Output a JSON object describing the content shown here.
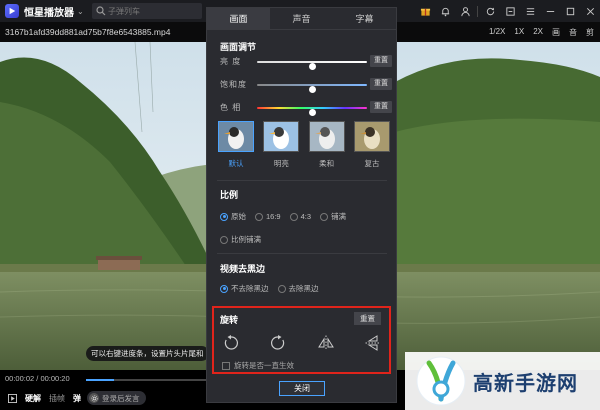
{
  "app": {
    "name": "恒星播放器"
  },
  "search": {
    "placeholder": "子弹列车"
  },
  "file": {
    "name": "3167b1afd39dd881ad75b7f8e6543885.mp4"
  },
  "view_options": [
    "1/2X",
    "1X",
    "2X",
    "画",
    "音",
    "剪"
  ],
  "tooltip": "可以右键进度条，设置片头片尾和",
  "playback": {
    "time": "00:00:02 / 00:00:20",
    "progress_fraction": 0.23
  },
  "controls": {
    "hard_decode": "硬解",
    "screenshot": "插帧",
    "danmaku": "弹",
    "danmaku_placeholder": "登录后发言"
  },
  "panel": {
    "tabs": [
      "画面",
      "声音",
      "字幕"
    ],
    "active_tab": 0,
    "image_adjust": {
      "title": "画面调节",
      "sliders": [
        {
          "label": "亮 度",
          "value": 0.5,
          "reset": "重置"
        },
        {
          "label": "饱和度",
          "value": 0.5,
          "reset": "重置"
        },
        {
          "label": "色 相",
          "value": 0.5,
          "reset": "重置"
        }
      ]
    },
    "presets": [
      {
        "label": "默认",
        "selected": true
      },
      {
        "label": "明亮",
        "selected": false
      },
      {
        "label": "柔和",
        "selected": false
      },
      {
        "label": "复古",
        "selected": false
      }
    ],
    "ratio": {
      "title": "比例",
      "options": [
        {
          "label": "原始",
          "checked": true
        },
        {
          "label": "16:9",
          "checked": false
        },
        {
          "label": "4:3",
          "checked": false
        },
        {
          "label": "铺满",
          "checked": false
        },
        {
          "label": "比例铺满",
          "checked": false
        }
      ]
    },
    "black_border": {
      "title": "视频去黑边",
      "options": [
        {
          "label": "不去除黑边",
          "checked": true
        },
        {
          "label": "去除黑边",
          "checked": false
        }
      ]
    },
    "rotate": {
      "title": "旋转",
      "reset": "重置",
      "icons": [
        "rotate-ccw-icon",
        "rotate-cw-icon",
        "flip-horizontal-icon",
        "flip-vertical-icon"
      ],
      "persist_label": "旋转是否一直生效"
    },
    "close": "关闭"
  },
  "watermark": {
    "text": "高新手游网"
  },
  "colors": {
    "accent": "#4aa3ff",
    "highlight": "#e0241b",
    "panel_bg": "#2a2b30",
    "topbar_bg": "#1b1c20"
  }
}
